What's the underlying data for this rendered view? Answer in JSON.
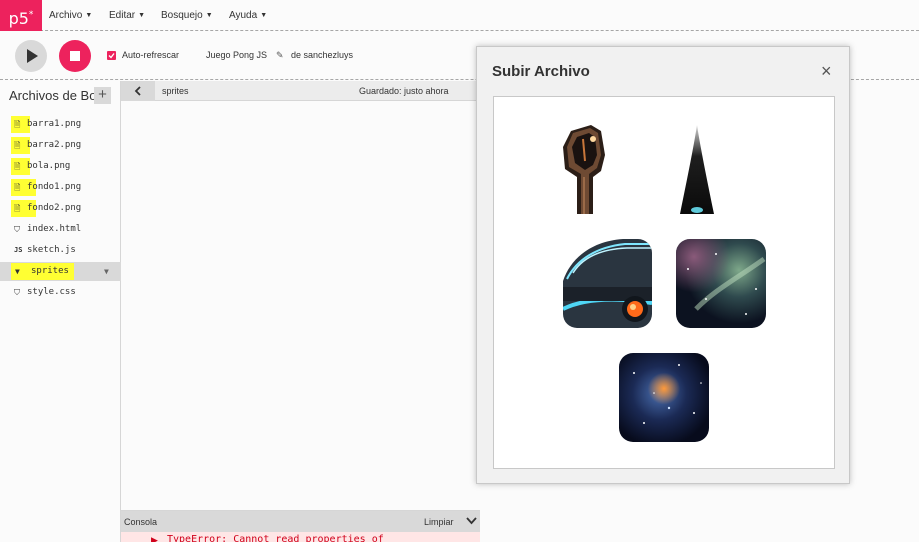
{
  "nav": {
    "logo": "p5",
    "logo_sup": "*",
    "menus": [
      "Archivo",
      "Editar",
      "Bosquejo",
      "Ayuda"
    ]
  },
  "toolbar": {
    "auto_refresh_label": "Auto-refrescar",
    "auto_refresh_checked": true,
    "sketch_name": "Juego Pong JS",
    "author": "de sanchezluys"
  },
  "sidebar": {
    "title": "Archivos de Bosquejo",
    "files": [
      {
        "name": "barra1.png",
        "icon": "image-file-icon"
      },
      {
        "name": "barra2.png",
        "icon": "image-file-icon"
      },
      {
        "name": "bola.png",
        "icon": "image-file-icon"
      },
      {
        "name": "fondo1.png",
        "icon": "image-file-icon"
      },
      {
        "name": "fondo2.png",
        "icon": "image-file-icon"
      },
      {
        "name": "index.html",
        "icon": "html-file-icon"
      },
      {
        "name": "sketch.js",
        "icon": "js-file-icon",
        "icon_text": "JS"
      },
      {
        "name": "sprites",
        "icon": "folder-icon"
      },
      {
        "name": "style.css",
        "icon": "css-file-icon"
      }
    ]
  },
  "editor": {
    "tab_name": "sprites",
    "saved_status": "Guardado: justo ahora"
  },
  "console": {
    "title": "Consola",
    "clear_label": "Limpiar",
    "error_text": "TypeError: Cannot read properties of"
  },
  "modal": {
    "title": "Subir Archivo",
    "close": "×"
  },
  "colors": {
    "accent": "#ed225d",
    "highlight": "#ffff33",
    "error": "#d0021b"
  }
}
